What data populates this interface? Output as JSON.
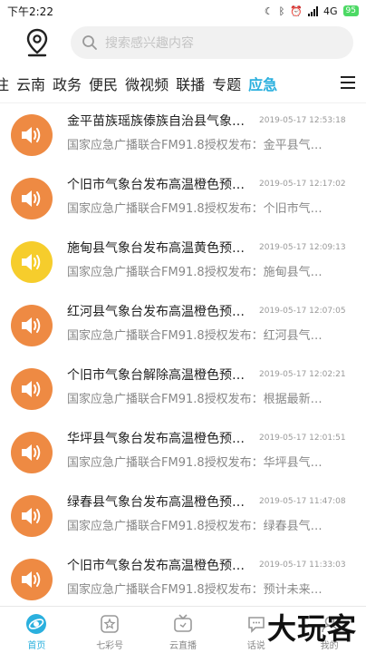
{
  "status_bar": {
    "time": "下午2:22",
    "network": "4G",
    "battery": "95"
  },
  "search": {
    "placeholder": "搜索感兴趣内容"
  },
  "tabs": [
    {
      "label": "注"
    },
    {
      "label": "云南"
    },
    {
      "label": "政务"
    },
    {
      "label": "便民"
    },
    {
      "label": "微视频"
    },
    {
      "label": "联播"
    },
    {
      "label": "专题"
    },
    {
      "label": "应急",
      "active": true
    }
  ],
  "items": [
    {
      "title": "金平苗族瑶族傣族自治县气象…",
      "time": "2019-05-17 12:53:18",
      "desc": "国家应急广播联合FM91.8授权发布：金平县气…",
      "color": "orange"
    },
    {
      "title": "个旧市气象台发布高温橙色预…",
      "time": "2019-05-17 12:17:02",
      "desc": "国家应急广播联合FM91.8授权发布：个旧市气…",
      "color": "orange"
    },
    {
      "title": "施甸县气象台发布高温黄色预…",
      "time": "2019-05-17 12:09:13",
      "desc": "国家应急广播联合FM91.8授权发布：施甸县气…",
      "color": "yellow"
    },
    {
      "title": "红河县气象台发布高温橙色预…",
      "time": "2019-05-17 12:07:05",
      "desc": "国家应急广播联合FM91.8授权发布：红河县气…",
      "color": "orange"
    },
    {
      "title": "个旧市气象台解除高温橙色预…",
      "time": "2019-05-17 12:02:21",
      "desc": "国家应急广播联合FM91.8授权发布：根据最新…",
      "color": "orange"
    },
    {
      "title": "华坪县气象台发布高温橙色预…",
      "time": "2019-05-17 12:01:51",
      "desc": "国家应急广播联合FM91.8授权发布：华坪县气…",
      "color": "orange"
    },
    {
      "title": "绿春县气象台发布高温橙色预…",
      "time": "2019-05-17 11:47:08",
      "desc": "国家应急广播联合FM91.8授权发布：绿春县气…",
      "color": "orange"
    },
    {
      "title": "个旧市气象台发布高温橙色预…",
      "time": "2019-05-17 11:33:03",
      "desc": "国家应急广播联合FM91.8授权发布：预计未来…",
      "color": "orange"
    }
  ],
  "colors": {
    "accent": "#2bb0de",
    "orange": "#ee8a43",
    "yellow": "#f6cd2c"
  },
  "bottom_nav": [
    {
      "label": "首页",
      "icon": "home-icon",
      "active": true
    },
    {
      "label": "七彩号",
      "icon": "star-icon"
    },
    {
      "label": "云直播",
      "icon": "tv-icon"
    },
    {
      "label": "话说",
      "icon": "chat-icon"
    },
    {
      "label": "我的",
      "icon": "user-icon"
    }
  ],
  "watermark": "大玩客"
}
